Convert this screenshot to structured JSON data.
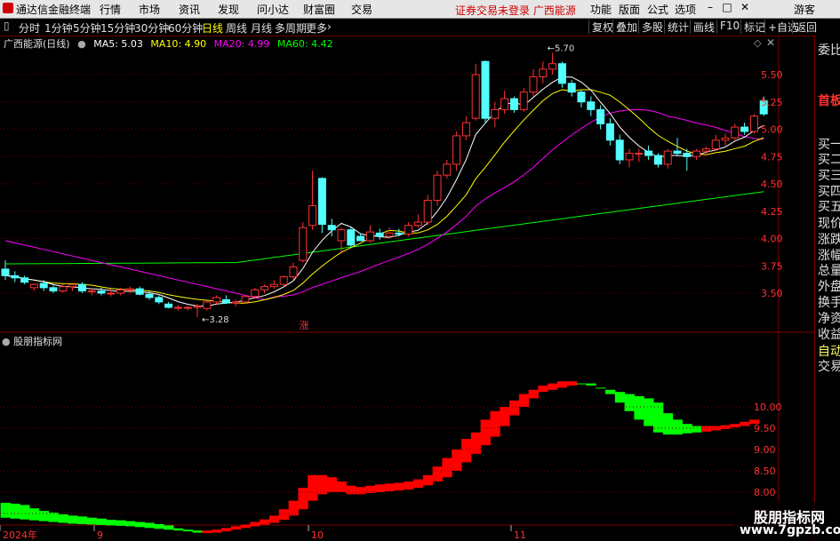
{
  "app": {
    "title": "通达信金融终端"
  },
  "menu": [
    "行情",
    "市场",
    "资讯",
    "发现",
    "问小达",
    "财富圈",
    "交易"
  ],
  "notice": "证券交易未登录  广西能源",
  "right_menu": [
    "功能",
    "版面",
    "公式",
    "选项",
    "游客"
  ],
  "periods": [
    "分时",
    "1分钟",
    "5分钟",
    "15分钟",
    "30分钟",
    "60分钟",
    "日线",
    "周线",
    "月线",
    "多周期",
    "更多"
  ],
  "active_period": "日线",
  "tools": [
    "复权",
    "叠加",
    "多股",
    "统计",
    "画线",
    "F10",
    "标记",
    "+自选",
    "返回"
  ],
  "info": {
    "stock": "广西能源(日线)",
    "ma5": "MA5: 5.03",
    "ma10": "MA10: 4.90",
    "ma20": "MA20: 4.99",
    "ma60": "MA60: 4.42"
  },
  "colors": {
    "up": "#ff3232",
    "down": "#54ffff",
    "ma5": "#ffffff",
    "ma10": "#ffff00",
    "ma20": "#ff00ff",
    "ma60": "#00ff00",
    "band_up": "#ff0000",
    "band_down": "#00ff00"
  },
  "annotations": {
    "high": "5.70",
    "low": "3.28",
    "zhang": "涨"
  },
  "indicator": {
    "title": "股朋指标网"
  },
  "chart_data": [
    {
      "type": "candlestick",
      "title": "广西能源(日线)",
      "ylim": [
        3.28,
        5.75
      ],
      "y_ticks": [
        "5.50",
        "5.25",
        "5.00",
        "4.75",
        "4.50",
        "4.25",
        "4.00",
        "3.75",
        "3.50"
      ],
      "x_labels": [
        "2024年",
        "9",
        "10",
        "11"
      ],
      "candles": [
        [
          3.72,
          3.8,
          3.62,
          3.66
        ],
        [
          3.66,
          3.7,
          3.6,
          3.64
        ],
        [
          3.64,
          3.66,
          3.58,
          3.6
        ],
        [
          3.55,
          3.59,
          3.52,
          3.58
        ],
        [
          3.59,
          3.62,
          3.52,
          3.55
        ],
        [
          3.55,
          3.57,
          3.5,
          3.52
        ],
        [
          3.52,
          3.58,
          3.5,
          3.56
        ],
        [
          3.56,
          3.58,
          3.52,
          3.58
        ],
        [
          3.58,
          3.6,
          3.5,
          3.52
        ],
        [
          3.52,
          3.55,
          3.48,
          3.52
        ],
        [
          3.52,
          3.55,
          3.48,
          3.5
        ],
        [
          3.5,
          3.54,
          3.47,
          3.5
        ],
        [
          3.5,
          3.55,
          3.48,
          3.53
        ],
        [
          3.53,
          3.56,
          3.5,
          3.54
        ],
        [
          3.54,
          3.56,
          3.48,
          3.49
        ],
        [
          3.49,
          3.52,
          3.44,
          3.46
        ],
        [
          3.46,
          3.48,
          3.4,
          3.42
        ],
        [
          3.4,
          3.42,
          3.36,
          3.37
        ],
        [
          3.37,
          3.39,
          3.34,
          3.37
        ],
        [
          3.37,
          3.38,
          3.34,
          3.37
        ],
        [
          3.37,
          3.4,
          3.28,
          3.38
        ],
        [
          3.36,
          3.43,
          3.34,
          3.42
        ],
        [
          3.42,
          3.48,
          3.4,
          3.46
        ],
        [
          3.44,
          3.48,
          3.4,
          3.41
        ],
        [
          3.41,
          3.44,
          3.38,
          3.42
        ],
        [
          3.42,
          3.48,
          3.4,
          3.47
        ],
        [
          3.47,
          3.55,
          3.45,
          3.53
        ],
        [
          3.53,
          3.58,
          3.5,
          3.56
        ],
        [
          3.56,
          3.62,
          3.54,
          3.58
        ],
        [
          3.58,
          3.66,
          3.56,
          3.65
        ],
        [
          3.65,
          3.78,
          3.62,
          3.74
        ],
        [
          3.8,
          4.15,
          3.78,
          4.1
        ],
        [
          4.12,
          4.62,
          4.08,
          4.3
        ],
        [
          4.55,
          4.56,
          4.05,
          4.13
        ],
        [
          4.12,
          4.18,
          4.02,
          4.08
        ],
        [
          3.98,
          4.1,
          3.86,
          4.08
        ],
        [
          4.08,
          4.1,
          3.92,
          3.94
        ],
        [
          4.02,
          4.05,
          3.98,
          3.98
        ],
        [
          3.98,
          4.12,
          3.96,
          4.06
        ],
        [
          4.05,
          4.09,
          3.99,
          4.02
        ],
        [
          4.02,
          4.1,
          4.0,
          4.05
        ],
        [
          4.05,
          4.09,
          4.02,
          4.04
        ],
        [
          4.04,
          4.15,
          4.02,
          4.12
        ],
        [
          4.12,
          4.22,
          4.1,
          4.15
        ],
        [
          4.15,
          4.4,
          4.12,
          4.35
        ],
        [
          4.35,
          4.62,
          4.3,
          4.58
        ],
        [
          4.58,
          4.72,
          4.55,
          4.68
        ],
        [
          4.68,
          4.98,
          4.62,
          4.94
        ],
        [
          4.94,
          5.12,
          4.9,
          5.06
        ],
        [
          5.1,
          5.6,
          5.08,
          5.5
        ],
        [
          5.62,
          5.63,
          5.05,
          5.1
        ],
        [
          5.1,
          5.25,
          5.02,
          5.18
        ],
        [
          5.18,
          5.35,
          5.14,
          5.28
        ],
        [
          5.28,
          5.3,
          5.15,
          5.18
        ],
        [
          5.18,
          5.38,
          5.16,
          5.34
        ],
        [
          5.34,
          5.55,
          5.3,
          5.48
        ],
        [
          5.48,
          5.62,
          5.42,
          5.55
        ],
        [
          5.55,
          5.7,
          5.5,
          5.6
        ],
        [
          5.6,
          5.62,
          5.38,
          5.42
        ],
        [
          5.42,
          5.45,
          5.3,
          5.34
        ],
        [
          5.34,
          5.36,
          5.2,
          5.25
        ],
        [
          5.25,
          5.3,
          5.12,
          5.18
        ],
        [
          5.18,
          5.22,
          5.0,
          5.05
        ],
        [
          5.05,
          5.1,
          4.85,
          4.9
        ],
        [
          4.9,
          4.95,
          4.68,
          4.72
        ],
        [
          4.72,
          4.82,
          4.65,
          4.78
        ],
        [
          4.78,
          4.82,
          4.7,
          4.78
        ],
        [
          4.8,
          4.85,
          4.72,
          4.76
        ],
        [
          4.76,
          4.78,
          4.65,
          4.68
        ],
        [
          4.68,
          4.82,
          4.64,
          4.8
        ],
        [
          4.8,
          4.92,
          4.75,
          4.78
        ],
        [
          4.78,
          4.82,
          4.62,
          4.75
        ],
        [
          4.75,
          4.82,
          4.72,
          4.8
        ],
        [
          4.8,
          4.84,
          4.76,
          4.82
        ],
        [
          4.82,
          4.95,
          4.8,
          4.9
        ],
        [
          4.9,
          4.96,
          4.85,
          4.92
        ],
        [
          4.92,
          5.05,
          4.9,
          5.02
        ],
        [
          5.02,
          5.06,
          4.95,
          4.98
        ],
        [
          4.98,
          5.14,
          4.96,
          5.12
        ],
        [
          5.26,
          5.3,
          5.12,
          5.14
        ]
      ]
    },
    {
      "type": "area",
      "title": "股朋指标网",
      "ylim": [
        7.3,
        10.7
      ],
      "y_ticks": [
        "10.00",
        "9.50",
        "9.00",
        "8.50",
        "8.00",
        "7.50"
      ],
      "x_labels": [
        "2024年",
        "9",
        "10",
        "11"
      ],
      "series": [
        {
          "values": [
            7.75,
            7.73,
            7.7,
            7.62,
            7.56,
            7.52,
            7.48,
            7.45,
            7.43,
            7.4,
            7.38,
            7.35,
            7.34,
            7.32,
            7.3,
            7.28,
            7.25,
            7.22,
            7.15,
            7.12,
            7.1,
            7.1,
            7.12,
            7.16,
            7.2,
            7.24,
            7.3,
            7.36,
            7.45,
            7.6,
            7.8,
            8.1,
            8.4,
            8.4,
            8.35,
            8.25,
            8.15,
            8.12,
            8.15,
            8.18,
            8.2,
            8.22,
            8.25,
            8.3,
            8.4,
            8.6,
            8.8,
            9.0,
            9.25,
            9.4,
            9.7,
            9.9,
            10.0,
            10.15,
            10.3,
            10.4,
            10.5,
            10.55,
            10.6,
            10.6,
            10.55,
            10.5,
            10.45,
            10.4,
            10.35,
            10.3,
            10.25,
            10.2,
            10.1,
            9.85,
            9.7,
            9.6,
            9.55,
            9.55,
            9.55,
            9.57,
            9.6,
            9.65,
            9.7,
            9.75
          ]
        },
        {
          "values": [
            7.4,
            7.38,
            7.36,
            7.34,
            7.32,
            7.3,
            7.28,
            7.26,
            7.25,
            7.24,
            7.23,
            7.22,
            7.21,
            7.2,
            7.18,
            7.16,
            7.14,
            7.12,
            7.1,
            7.08,
            7.05,
            7.04,
            7.05,
            7.08,
            7.12,
            7.16,
            7.2,
            7.24,
            7.28,
            7.35,
            7.45,
            7.6,
            7.8,
            7.95,
            8.0,
            8.0,
            7.95,
            7.95,
            7.98,
            8.0,
            8.02,
            8.04,
            8.06,
            8.1,
            8.16,
            8.25,
            8.35,
            8.5,
            8.7,
            8.9,
            9.1,
            9.3,
            9.55,
            9.8,
            10.0,
            10.2,
            10.35,
            10.4,
            10.45,
            10.5,
            10.55,
            10.55,
            10.45,
            10.3,
            10.1,
            9.9,
            9.7,
            9.55,
            9.4,
            9.35,
            9.35,
            9.38,
            9.4,
            9.42,
            9.45,
            9.48,
            9.52,
            9.55,
            9.6,
            9.65
          ]
        }
      ]
    }
  ]
}
